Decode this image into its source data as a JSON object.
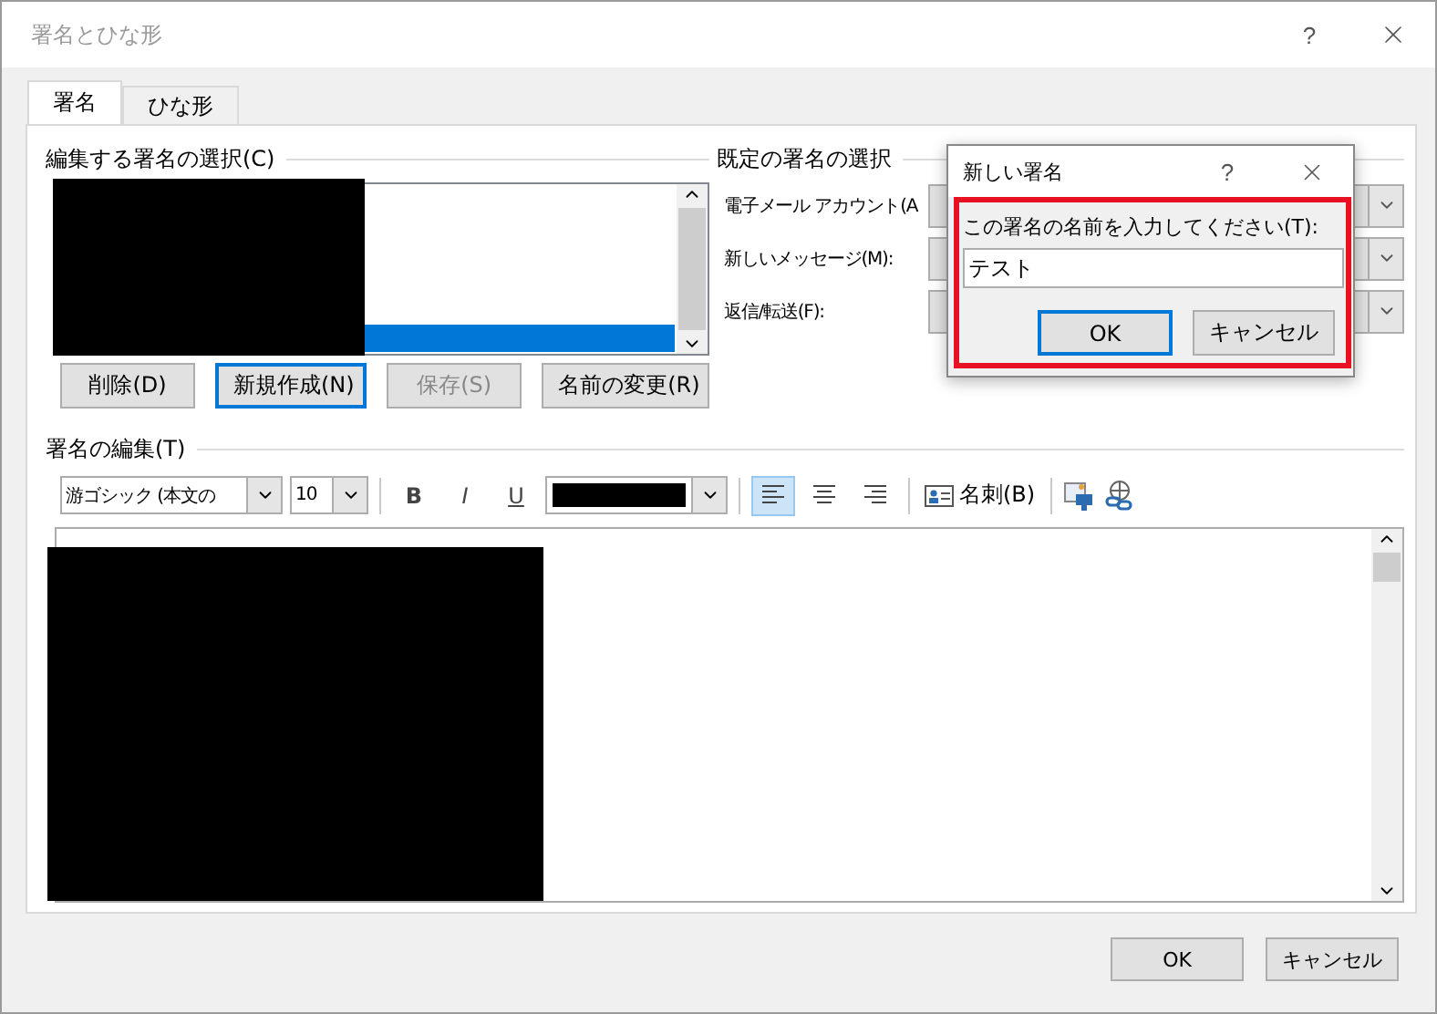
{
  "window": {
    "title": "署名とひな形",
    "help": "?"
  },
  "tabs": [
    {
      "label": "署名",
      "selected": true
    },
    {
      "label": "ひな形",
      "selected": false
    }
  ],
  "select_signature": {
    "heading": "編集する署名の選択(C)",
    "items": [
      {
        "selected": true
      }
    ],
    "buttons": [
      {
        "label": "削除(D)",
        "disabled": false,
        "focused": false
      },
      {
        "label": "新規作成(N)",
        "disabled": false,
        "focused": true
      },
      {
        "label": "保存(S)",
        "disabled": true,
        "focused": false
      },
      {
        "label": "名前の変更(R)",
        "disabled": false,
        "focused": false
      }
    ]
  },
  "default_signature": {
    "heading": "既定の署名の選択",
    "rows": [
      {
        "label": "電子メール アカウント(A"
      },
      {
        "label": "新しいメッセージ(M):"
      },
      {
        "label": "返信/転送(F):"
      }
    ]
  },
  "edit_signature": {
    "heading": "署名の編集(T)",
    "font": "游ゴシック (本文の",
    "size": "10",
    "bold": "B",
    "italic": "I",
    "underline": "U",
    "align": [
      {
        "kind": "left",
        "selected": true
      },
      {
        "kind": "center",
        "selected": false
      },
      {
        "kind": "right",
        "selected": false
      }
    ],
    "business_card": "名刺(B)"
  },
  "dialog": {
    "title": "新しい署名",
    "help": "?",
    "prompt": "この署名の名前を入力してください(T):",
    "value": "テスト",
    "ok": "OK",
    "cancel": "キャンセル"
  },
  "footer": {
    "ok": "OK",
    "cancel": "キャンセル"
  }
}
